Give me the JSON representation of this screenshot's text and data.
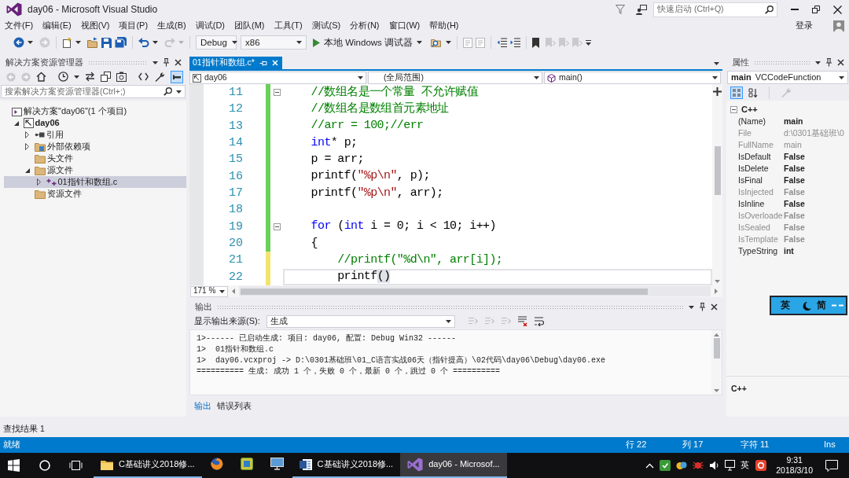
{
  "window": {
    "title": "day06 - Microsoft Visual Studio",
    "quick_launch": {
      "placeholder": "快速启动 (Ctrl+Q)"
    }
  },
  "menu": {
    "items": [
      "文件(F)",
      "编辑(E)",
      "视图(V)",
      "项目(P)",
      "生成(B)",
      "调试(D)",
      "团队(M)",
      "工具(T)",
      "测试(S)",
      "分析(N)",
      "窗口(W)",
      "帮助(H)"
    ],
    "sign_in": "登录"
  },
  "toolbar": {
    "configuration": "Debug",
    "platform": "x86",
    "start_debugging": "本地 Windows 调试器"
  },
  "solution_explorer": {
    "title": "解决方案资源管理器",
    "search": {
      "placeholder": "搜索解决方案资源管理器(Ctrl+;)"
    },
    "tree": [
      {
        "label": "解决方案\"day06\"(1 个项目)",
        "kind": "solution",
        "selected": false,
        "children": [
          {
            "label": "day06",
            "kind": "project",
            "expanded": true,
            "selected": false,
            "children": [
              {
                "label": "引用",
                "kind": "references",
                "expanded": false,
                "selected": false
              },
              {
                "label": "外部依赖项",
                "kind": "dependencies",
                "expanded": false,
                "selected": false
              },
              {
                "label": "头文件",
                "kind": "folder",
                "selected": false
              },
              {
                "label": "源文件",
                "kind": "folder",
                "expanded": true,
                "selected": false,
                "children": [
                  {
                    "label": "01指针和数组.c",
                    "kind": "source",
                    "expanded": false,
                    "selected": true
                  }
                ]
              },
              {
                "label": "资源文件",
                "kind": "folder",
                "selected": false
              }
            ]
          }
        ]
      }
    ]
  },
  "editor": {
    "tabs": [
      {
        "label": "01指针和数组.c*",
        "selected": true
      }
    ],
    "navigation": {
      "project": "day06",
      "scope": "(全局范围)",
      "member": "main()"
    },
    "lines": [
      {
        "number": "11",
        "saved": true,
        "fold_start": true,
        "current": false,
        "tokens": [
          {
            "kind": "comment",
            "text": "    //数组名是一个常量 不允许赋值"
          }
        ]
      },
      {
        "number": "12",
        "saved": true,
        "fold_start": false,
        "current": false,
        "tokens": [
          {
            "kind": "comment",
            "text": "    //数组名是数组首元素地址"
          }
        ]
      },
      {
        "number": "13",
        "saved": true,
        "fold_start": false,
        "current": false,
        "tokens": [
          {
            "kind": "comment",
            "text": "    //arr = 100;//err"
          }
        ]
      },
      {
        "number": "14",
        "saved": true,
        "fold_start": false,
        "current": false,
        "tokens": [
          {
            "kind": "keyword",
            "text": "    int"
          },
          {
            "kind": "plain",
            "text": "* p;"
          }
        ]
      },
      {
        "number": "15",
        "saved": true,
        "fold_start": false,
        "current": false,
        "tokens": [
          {
            "kind": "plain",
            "text": "    p = arr;"
          }
        ]
      },
      {
        "number": "16",
        "saved": true,
        "fold_start": false,
        "current": false,
        "tokens": [
          {
            "kind": "plain",
            "text": "    printf("
          },
          {
            "kind": "string",
            "text": "\"%p\\n\""
          },
          {
            "kind": "plain",
            "text": ", p);"
          }
        ]
      },
      {
        "number": "17",
        "saved": true,
        "fold_start": false,
        "current": false,
        "tokens": [
          {
            "kind": "plain",
            "text": "    printf("
          },
          {
            "kind": "string",
            "text": "\"%p\\n\""
          },
          {
            "kind": "plain",
            "text": ", arr);"
          }
        ]
      },
      {
        "number": "18",
        "saved": true,
        "fold_start": false,
        "current": false
      },
      {
        "number": "19",
        "saved": true,
        "fold_start": true,
        "current": false,
        "tokens": [
          {
            "kind": "keyword",
            "text": "    for"
          },
          {
            "kind": "plain",
            "text": " ("
          },
          {
            "kind": "keyword",
            "text": "int"
          },
          {
            "kind": "plain",
            "text": " i = 0; i < 10; i++)"
          }
        ]
      },
      {
        "number": "20",
        "saved": true,
        "fold_start": false,
        "current": false,
        "tokens": [
          {
            "kind": "plain",
            "text": "    {"
          }
        ]
      },
      {
        "number": "21",
        "saved": false,
        "fold_start": false,
        "current": false,
        "tokens": [
          {
            "kind": "comment",
            "text": "        //printf(\"%d\\n\", arr[i]);"
          }
        ]
      },
      {
        "number": "22",
        "saved": false,
        "fold_start": false,
        "current": true,
        "tokens": [
          {
            "kind": "plain",
            "text": "        printf"
          },
          {
            "kind": "brace_match",
            "text": "()"
          }
        ]
      }
    ],
    "zoom": "171 %"
  },
  "output": {
    "title": "输出",
    "source_label": "显示输出来源(S):",
    "source": "生成",
    "lines": [
      "1>------ 已启动生成: 项目: day06, 配置: Debug Win32 ------",
      "1>  01指针和数组.c",
      "1>  day06.vcxproj -> D:\\0301基础班\\01_C语言实战06天（指针提高）\\02代码\\day06\\Debug\\day06.exe",
      "========== 生成: 成功 1 个，失败 0 个，最新 0 个，跳过 0 个 =========="
    ],
    "tabs": [
      {
        "label": "输出",
        "selected": true
      },
      {
        "label": "错误列表",
        "selected": false
      }
    ]
  },
  "properties": {
    "title": "属性",
    "object_name": "main",
    "object_type": "VCCodeFunction",
    "category": {
      "label": "C++",
      "expanded": true
    },
    "rows": [
      {
        "name": "(Name)",
        "value": "main",
        "bold": true,
        "disabled": false
      },
      {
        "name": "File",
        "value": "d:\\0301基础班\\0",
        "bold": false,
        "disabled": true
      },
      {
        "name": "FullName",
        "value": "main",
        "bold": false,
        "disabled": true
      },
      {
        "name": "IsDefault",
        "value": "False",
        "bold": true,
        "disabled": false
      },
      {
        "name": "IsDelete",
        "value": "False",
        "bold": true,
        "disabled": false
      },
      {
        "name": "IsFinal",
        "value": "False",
        "bold": true,
        "disabled": false
      },
      {
        "name": "IsInjected",
        "value": "False",
        "bold": true,
        "disabled": true
      },
      {
        "name": "IsInline",
        "value": "False",
        "bold": true,
        "disabled": false
      },
      {
        "name": "IsOverloade",
        "value": "False",
        "bold": true,
        "disabled": true
      },
      {
        "name": "IsSealed",
        "value": "False",
        "bold": true,
        "disabled": true
      },
      {
        "name": "IsTemplate",
        "value": "False",
        "bold": true,
        "disabled": true
      },
      {
        "name": "TypeString",
        "value": "int",
        "bold": true,
        "disabled": false
      }
    ],
    "description": "C++"
  },
  "find_results_tab": "查找结果 1",
  "status_bar": {
    "message": "就绪",
    "line": "行 22",
    "column": "列 17",
    "character": "字符 11",
    "mode": "Ins"
  },
  "ime_bar": {
    "language": "英",
    "script": "简"
  },
  "taskbar": {
    "apps": [
      {
        "kind": "explorer",
        "label": "C基础讲义2018修...",
        "running": true,
        "selected": false
      },
      {
        "kind": "firefox",
        "running": false,
        "selected": false
      },
      {
        "kind": "tile",
        "running": false,
        "selected": false
      },
      {
        "kind": "monitor",
        "running": false,
        "selected": false
      },
      {
        "kind": "word",
        "label": "C基础讲义2018修...",
        "running": true,
        "selected": false
      },
      {
        "kind": "visual_studio",
        "label": "day06 - Microsof...",
        "running": true,
        "selected": true
      }
    ],
    "tray_language": "英",
    "time": "9:31",
    "date": "2018/3/10"
  }
}
